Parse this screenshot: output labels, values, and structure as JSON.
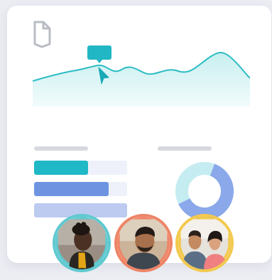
{
  "dashboard": {
    "logo_icon": "document-shield-icon",
    "cursor_icon": "pointer-cursor-icon",
    "tooltip_icon": "tooltip-bubble-icon",
    "bars": [
      {
        "color": "#1fb8c6",
        "fill": 0.58
      },
      {
        "color": "#6e94e1",
        "fill": 0.8
      },
      {
        "color": "#bccbef",
        "fill": 1.0
      }
    ],
    "donut": {
      "segments": [
        {
          "color": "#8aa8ea",
          "fraction": 0.62
        },
        {
          "color": "#c5ecf1",
          "fraction": 0.38
        }
      ]
    }
  },
  "people": [
    {
      "ring_color": "#5fc9d0",
      "icon": "person-photo"
    },
    {
      "ring_color": "#ee8466",
      "icon": "person-photo"
    },
    {
      "ring_color": "#f3c94e",
      "icon": "people-photo"
    }
  ],
  "colors": {
    "accent": "#1fb8c6",
    "line": "#2bbdc4",
    "area": "#d9f3f4",
    "secondary": "#6e94e1"
  }
}
